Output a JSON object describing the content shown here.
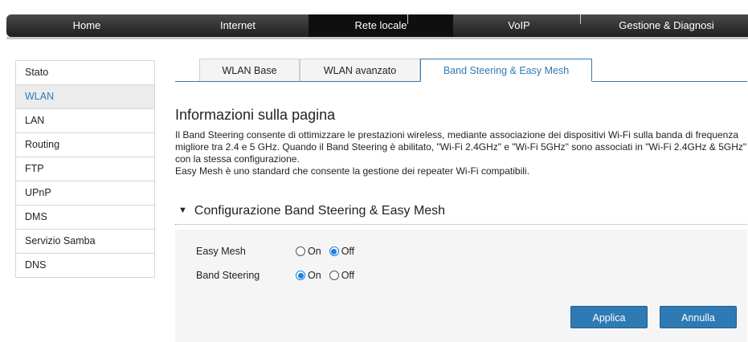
{
  "nav": {
    "items": [
      {
        "label": "Home"
      },
      {
        "label": "Internet"
      },
      {
        "label": "Rete locale"
      },
      {
        "label": "VoIP"
      },
      {
        "label": "Gestione & Diagnosi"
      }
    ],
    "active": "Rete locale"
  },
  "sidebar": {
    "items": [
      {
        "label": "Stato"
      },
      {
        "label": "WLAN"
      },
      {
        "label": "LAN"
      },
      {
        "label": "Routing"
      },
      {
        "label": "FTP"
      },
      {
        "label": "UPnP"
      },
      {
        "label": "DMS"
      },
      {
        "label": "Servizio Samba"
      },
      {
        "label": "DNS"
      }
    ],
    "active": "WLAN"
  },
  "tabs": {
    "items": [
      {
        "label": "WLAN Base"
      },
      {
        "label": "WLAN avanzato"
      },
      {
        "label": "Band Steering & Easy Mesh"
      }
    ],
    "active": "Band Steering & Easy Mesh"
  },
  "info": {
    "heading": "Informazioni sulla pagina",
    "paragraph1": "Il Band Steering consente di ottimizzare le prestazioni wireless, mediante associazione dei dispositivi Wi-Fi sulla banda di frequenza migliore tra 2.4 e 5 GHz. Quando il Band Steering è abilitato, \"Wi-Fi 2.4GHz\" e \"Wi-Fi 5GHz\" sono associati in \"Wi-Fi 2.4GHz & 5GHz\" con la stessa configurazione.",
    "paragraph2": "Easy Mesh è uno standard che consente la gestione dei repeater Wi-Fi compatibili."
  },
  "config": {
    "title": "Configurazione Band Steering & Easy Mesh",
    "easy_mesh": {
      "label": "Easy Mesh",
      "on_label": "On",
      "off_label": "Off",
      "value": "Off"
    },
    "band_steering": {
      "label": "Band Steering",
      "on_label": "On",
      "off_label": "Off",
      "value": "On"
    }
  },
  "buttons": {
    "apply": "Applica",
    "cancel": "Annulla"
  },
  "colors": {
    "accent": "#2e7ab4",
    "radio_checked": "#1c7fe0",
    "nav_bg": "#2b2b2b"
  }
}
